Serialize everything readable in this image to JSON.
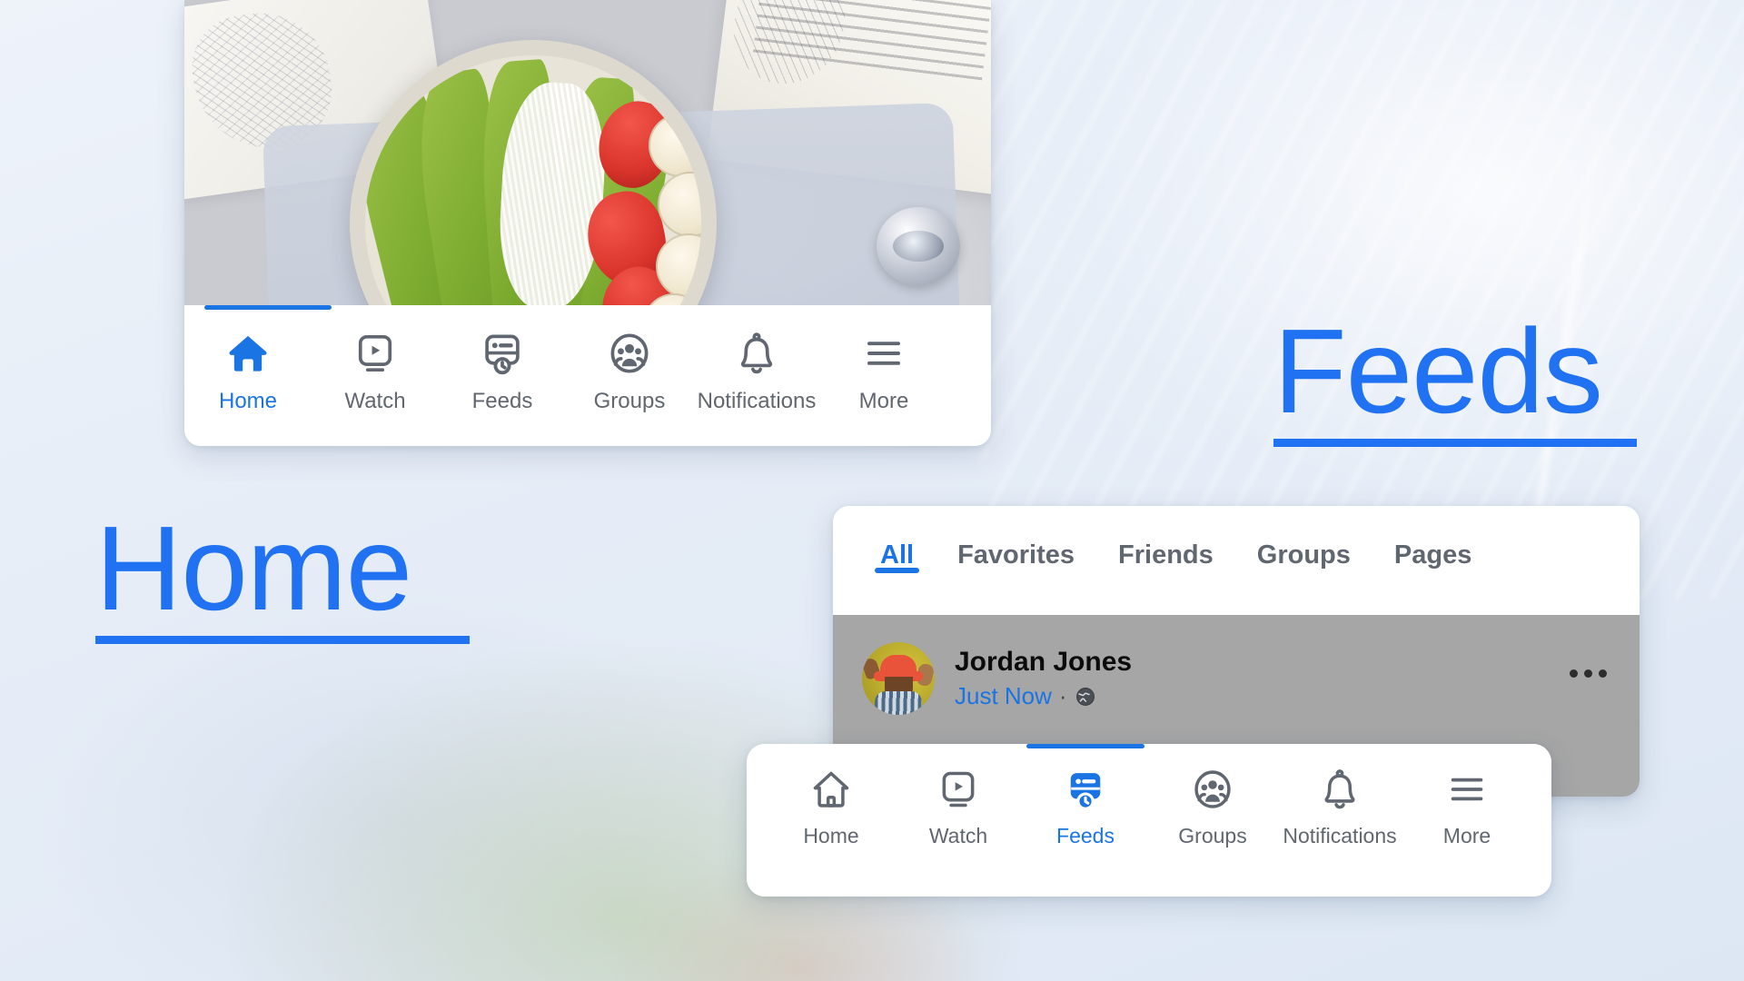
{
  "annotations": [
    {
      "id": "home",
      "text": "Home",
      "color": "#2072f3",
      "underline": true
    },
    {
      "id": "feeds",
      "text": "Feeds",
      "color": "#2072f3",
      "underline": true
    }
  ],
  "top_card": {
    "photo_alt": "smoothie bowl with kiwi, coconut, strawberry and banana next to open books",
    "navbar": {
      "active_index": 0,
      "items": [
        {
          "label": "Home",
          "icon": "home-icon",
          "state": "active"
        },
        {
          "label": "Watch",
          "icon": "watch-icon",
          "state": "inactive"
        },
        {
          "label": "Feeds",
          "icon": "feeds-icon",
          "state": "inactive"
        },
        {
          "label": "Groups",
          "icon": "groups-icon",
          "state": "inactive"
        },
        {
          "label": "Notifications",
          "icon": "notifications-icon",
          "state": "inactive"
        },
        {
          "label": "More",
          "icon": "more-menu-icon",
          "state": "inactive"
        }
      ]
    }
  },
  "feed_card": {
    "tabs": {
      "active_index": 0,
      "items": [
        {
          "label": "All",
          "state": "active"
        },
        {
          "label": "Favorites",
          "state": "inactive"
        },
        {
          "label": "Friends",
          "state": "inactive"
        },
        {
          "label": "Groups",
          "state": "inactive"
        },
        {
          "label": "Pages",
          "state": "inactive"
        }
      ]
    },
    "post": {
      "author": "Jordan Jones",
      "timestamp": "Just Now",
      "separator": "·",
      "audience_icon": "globe-icon",
      "avatar_alt": "person in orange bucket hat waving",
      "more_icon": "ellipsis-icon"
    }
  },
  "bottom_card": {
    "navbar": {
      "active_index": 2,
      "items": [
        {
          "label": "Home",
          "icon": "home-icon",
          "state": "inactive"
        },
        {
          "label": "Watch",
          "icon": "watch-icon",
          "state": "inactive"
        },
        {
          "label": "Feeds",
          "icon": "feeds-icon",
          "state": "active"
        },
        {
          "label": "Groups",
          "icon": "groups-icon",
          "state": "inactive"
        },
        {
          "label": "Notifications",
          "icon": "notifications-icon",
          "state": "inactive"
        },
        {
          "label": "More",
          "icon": "more-menu-icon",
          "state": "inactive"
        }
      ]
    }
  },
  "colors": {
    "accent_blue": "#1b74e4",
    "annotation_blue": "#2072f3",
    "icon_gray": "#606770",
    "post_overlay_gray": "#a6a6a6",
    "card_white": "#ffffff",
    "page_background": "#e8eef7"
  }
}
